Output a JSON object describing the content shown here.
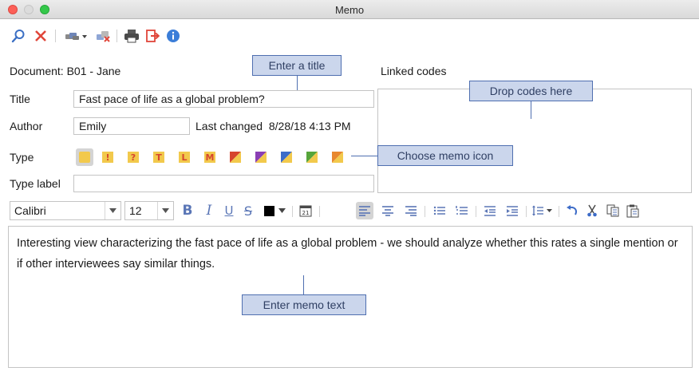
{
  "window": {
    "title": "Memo"
  },
  "toolbar": {
    "buttons": [
      {
        "name": "search-icon"
      },
      {
        "name": "close-icon"
      },
      {
        "name": "link-dropdown-icon"
      },
      {
        "name": "delete-link-icon"
      },
      {
        "name": "print-icon"
      },
      {
        "name": "export-icon"
      },
      {
        "name": "info-icon"
      }
    ]
  },
  "document": {
    "label": "Document:",
    "value": "B01 - Jane"
  },
  "linked_codes": {
    "label": "Linked codes"
  },
  "title_field": {
    "label": "Title",
    "value": "Fast pace of life as a global problem?"
  },
  "author_field": {
    "label": "Author",
    "value": "Emily"
  },
  "last_changed": {
    "label": "Last changed",
    "value": "8/28/18 4:13 PM"
  },
  "type": {
    "label": "Type",
    "icons": [
      {
        "name": "memo-type-yellow",
        "glyph": ""
      },
      {
        "name": "memo-type-exclamation",
        "glyph": "!"
      },
      {
        "name": "memo-type-question",
        "glyph": "?"
      },
      {
        "name": "memo-type-t",
        "glyph": "T"
      },
      {
        "name": "memo-type-l",
        "glyph": "L"
      },
      {
        "name": "memo-type-m",
        "glyph": "M"
      },
      {
        "name": "memo-type-red-yellow",
        "colors": [
          "#d6452e",
          "#f2c94c"
        ]
      },
      {
        "name": "memo-type-purple-yellow",
        "colors": [
          "#8a3fb4",
          "#f2c94c"
        ]
      },
      {
        "name": "memo-type-blue-yellow",
        "colors": [
          "#3d6cc8",
          "#f2c94c"
        ]
      },
      {
        "name": "memo-type-green-yellow",
        "colors": [
          "#57a53a",
          "#f2c94c"
        ]
      },
      {
        "name": "memo-type-orange-yellow",
        "colors": [
          "#e8872e",
          "#f2c94c"
        ]
      }
    ]
  },
  "type_label": {
    "label": "Type label",
    "value": ""
  },
  "callouts": {
    "title": "Enter a title",
    "codes": "Drop codes here",
    "icon": "Choose memo icon",
    "text": "Enter memo text"
  },
  "format": {
    "font": "Calibri",
    "size": "12",
    "text_color": "#000000"
  },
  "memo": {
    "text": "Interesting view characterizing the fast pace of life as a global problem - we should analyze whether this rates a single mention or if other interviewees say similar things."
  },
  "colors": {
    "accent": "#4f6fb0",
    "callout_fill": "#cbd6ec",
    "close_red": "#e0463a",
    "info_blue": "#3b7dd8"
  }
}
